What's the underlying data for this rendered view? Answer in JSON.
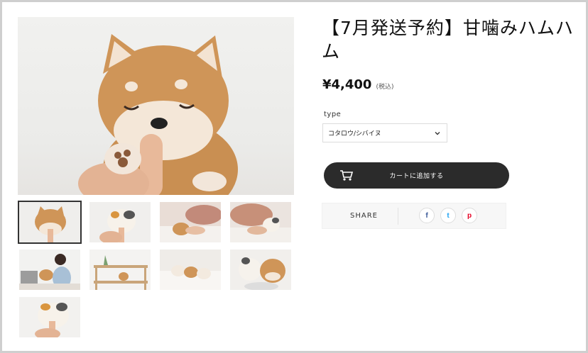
{
  "product": {
    "title": "【7月発送予約】甘噛みハムハム",
    "price": "¥4,400",
    "tax_note": "(税込)"
  },
  "options": {
    "type_label": "type",
    "type_selected": "コタロウ/シバイヌ"
  },
  "cart": {
    "button_label": "カートに追加する"
  },
  "share": {
    "label": "SHARE",
    "facebook_glyph": "f",
    "twitter_glyph": "t",
    "pinterest_glyph": "p"
  },
  "colors": {
    "cart_button": "#2b2b2b",
    "facebook": "#3b5998",
    "twitter": "#1da1f2",
    "pinterest": "#e60023"
  }
}
